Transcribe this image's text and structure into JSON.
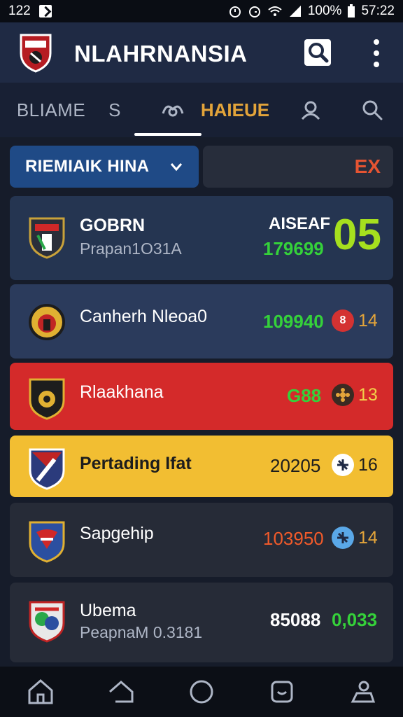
{
  "status": {
    "time": "122",
    "battery": "100%",
    "clock": "57:22"
  },
  "header": {
    "title": "NLAHRNANSIA"
  },
  "tabs": [
    {
      "label": "BLIAME"
    },
    {
      "label": "S"
    },
    {
      "label": ""
    },
    {
      "label": "HAIEUE"
    }
  ],
  "filter": {
    "dropdown_label": "RIEMIAIK HINA",
    "right_label": "EX"
  },
  "cards": [
    {
      "name": "GOBRN",
      "sub": "Prapan1O31A",
      "label": "AISEAF",
      "value": "179699",
      "score": "05"
    },
    {
      "name": "Canherh Nleoa0",
      "value": "109940",
      "badge": "8",
      "count": "14"
    },
    {
      "name": "Rlaakhana",
      "value": "G88",
      "badge": "",
      "count": "13"
    },
    {
      "name": "Pertading Ifat",
      "value": "20205",
      "badge": "",
      "count": "16"
    },
    {
      "name": "Sapgehip",
      "value": "103950",
      "badge": "",
      "count": "14"
    },
    {
      "name": "Ubema",
      "sub": "PeapnaM 0.3181",
      "value": "85088",
      "extra": "0,033"
    }
  ],
  "colors": {
    "app_bg": "#161c2a",
    "appbar": "#1f2a44",
    "accent_orange": "#e3a43a",
    "green": "#35d13a",
    "red_card": "#d42a2a",
    "yellow_card": "#f2be32",
    "blue_card": "#2b3b5c"
  },
  "icons": [
    "search-icon",
    "more-icon",
    "chevron-down-icon",
    "home-icon",
    "back-icon",
    "circle-icon",
    "app-icon",
    "profile-icon"
  ]
}
